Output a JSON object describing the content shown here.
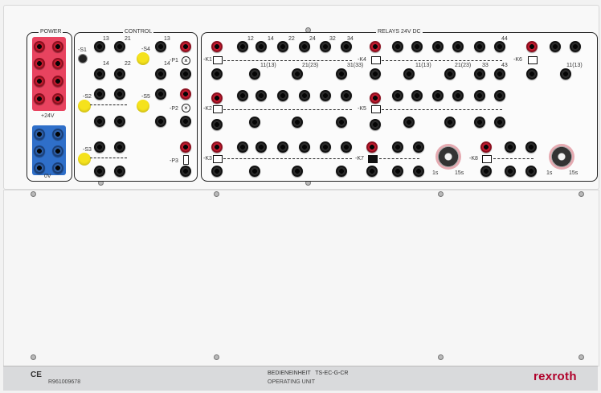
{
  "title": "BEDIENEINHEIT   TS-EC-G-CR",
  "subtitle": "OPERATING UNIT",
  "part_number": "R961009678",
  "ce_mark": "CE",
  "brand": "rexroth",
  "sections": {
    "power": "POWER",
    "control": "CONTROL",
    "relays": "RELAYS  24V DC"
  },
  "power_labels": {
    "v24": "+24V",
    "v0": "0V"
  },
  "control_labels": {
    "s1": "-S1",
    "s2": "-S2",
    "s3": "-S3",
    "s4": "-S4",
    "s5": "-S5",
    "p1": "-P1",
    "p2": "-P2",
    "p3": "-P3",
    "n13": "13",
    "n14": "14",
    "n21": "21",
    "n22": "22"
  },
  "relay_labels": {
    "k1": "-K1",
    "k2": "-K2",
    "k3": "-K3",
    "k4": "-K4",
    "k5": "-K5",
    "k6": "-K6",
    "k7": "-K7",
    "k8": "-K8",
    "a1": "A1",
    "a2": "A2",
    "c12": "12",
    "c14": "14",
    "c22": "22",
    "c24": "24",
    "c32": "32",
    "c34": "34",
    "c44": "44",
    "c13": "13",
    "c21": "21",
    "t11": "11(13)",
    "t21": "21(23)",
    "t31": "31(33)",
    "t33": "33",
    "t43": "43",
    "t1s": "1s",
    "t15s": "15s"
  }
}
